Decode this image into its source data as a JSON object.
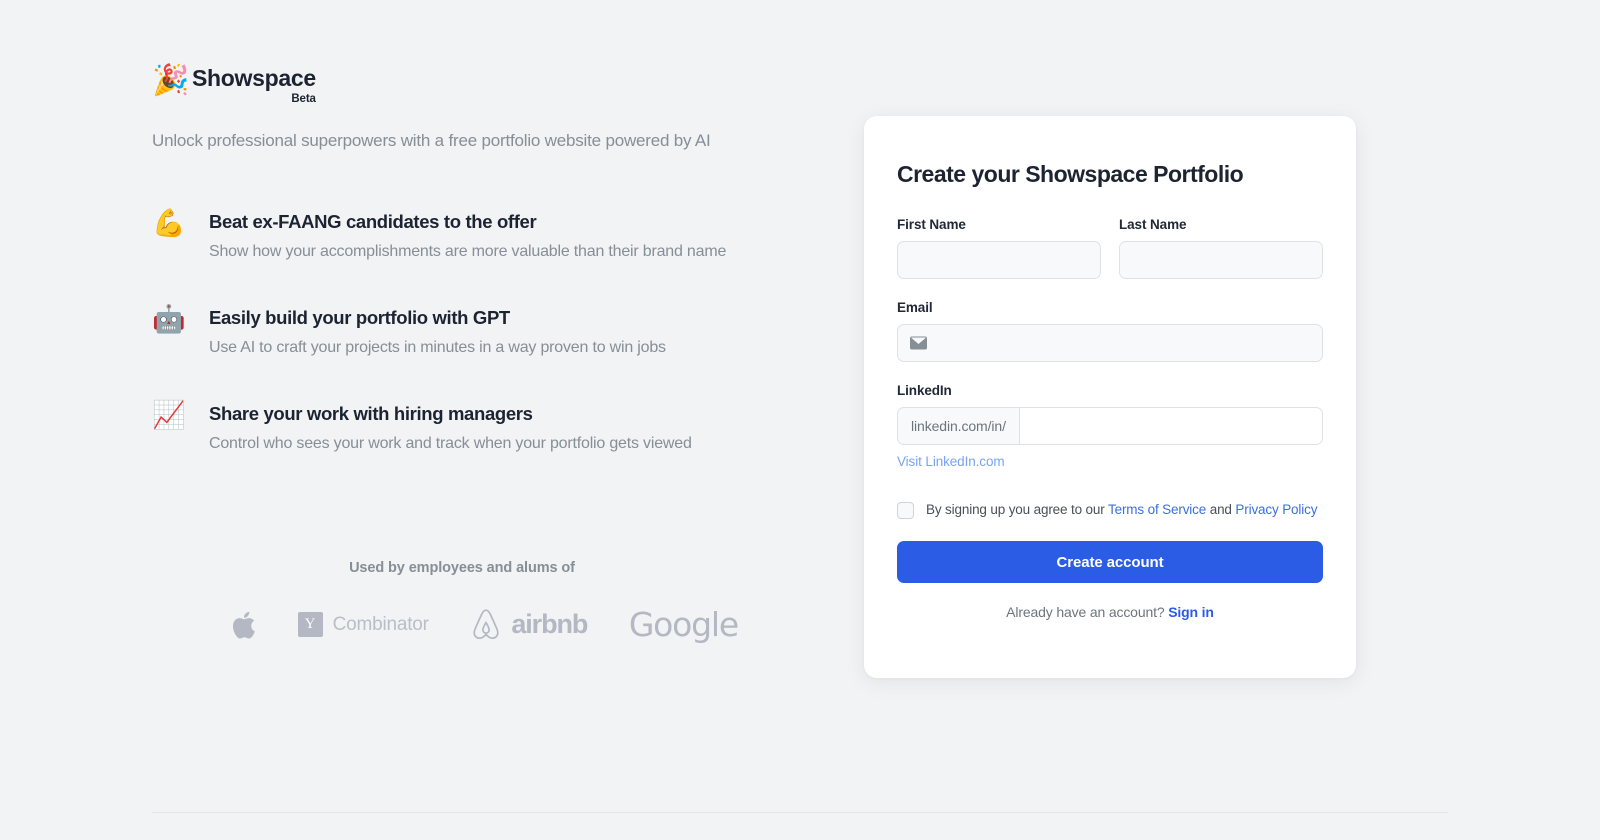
{
  "brand": {
    "emoji": "🎉",
    "emoji_name": "party-popper-icon",
    "name": "Showspace",
    "badge": "Beta",
    "tagline": "Unlock professional superpowers with a free portfolio website powered by AI"
  },
  "features": [
    {
      "emoji": "💪",
      "emoji_name": "flexed-biceps-icon",
      "title": "Beat ex-FAANG candidates to the offer",
      "subtitle": "Show how your accomplishments are more valuable than their brand name"
    },
    {
      "emoji": "🤖",
      "emoji_name": "robot-icon",
      "title": "Easily build your portfolio with GPT",
      "subtitle": "Use AI to craft your projects in minutes in a way proven to win jobs"
    },
    {
      "emoji": "📈",
      "emoji_name": "chart-increasing-icon",
      "title": "Share your work with hiring managers",
      "subtitle": "Control who sees your work and track when your portfolio gets viewed"
    }
  ],
  "social_proof": {
    "caption": "Used by employees and alums of",
    "logos": [
      {
        "name": "apple-logo",
        "label": "Apple"
      },
      {
        "name": "ycombinator-logo",
        "label": "Combinator",
        "mark": "Y"
      },
      {
        "name": "airbnb-logo",
        "label": "airbnb"
      },
      {
        "name": "google-logo",
        "label": "Google"
      }
    ]
  },
  "signup_card": {
    "title": "Create your Showspace Portfolio",
    "first_name": {
      "label": "First Name",
      "value": "",
      "placeholder": ""
    },
    "last_name": {
      "label": "Last Name",
      "value": "",
      "placeholder": ""
    },
    "email": {
      "label": "Email",
      "value": "",
      "placeholder": "",
      "icon": "envelope-icon"
    },
    "linkedin": {
      "label": "LinkedIn",
      "prefix": "linkedin.com/in/",
      "value": "",
      "placeholder": "",
      "helper_link": "Visit LinkedIn.com"
    },
    "terms": {
      "checked": false,
      "prefix": "By signing up you agree to our ",
      "terms_link": "Terms of Service",
      "conjunction": " and ",
      "privacy_link": "Privacy Policy"
    },
    "submit_label": "Create account",
    "signin_prompt": "Already have an account? ",
    "signin_link": "Sign in"
  },
  "colors": {
    "background": "#f1f3f5",
    "card": "#ffffff",
    "primary": "#2b5ce6",
    "link": "#3b6fe0",
    "muted": "#868e96",
    "heading": "#1c2431"
  }
}
